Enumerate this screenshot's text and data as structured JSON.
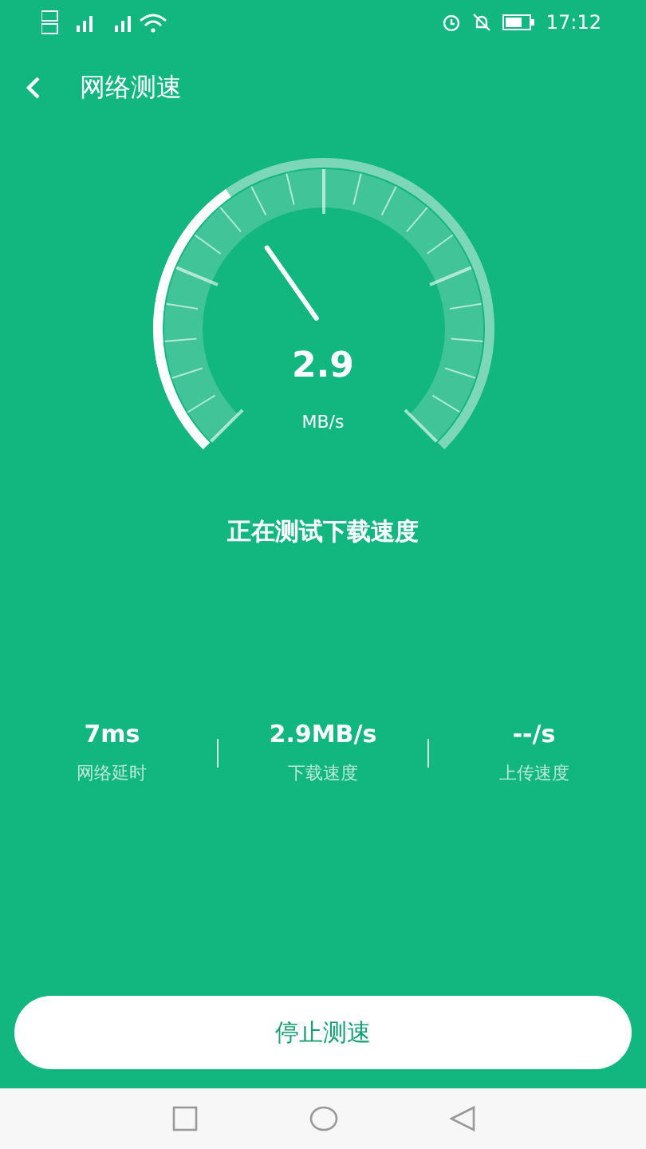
{
  "status_bar": {
    "time": "17:12"
  },
  "header": {
    "title": "网络测速"
  },
  "gauge": {
    "reading": "2.9",
    "unit": "MB/s"
  },
  "status_text": "正在测试下载速度",
  "stats": [
    {
      "value": "7ms",
      "label": "网络延时"
    },
    {
      "value": "2.9MB/s",
      "label": "下载速度"
    },
    {
      "value": "--/s",
      "label": "上传速度"
    }
  ],
  "stop_button": "停止测速"
}
